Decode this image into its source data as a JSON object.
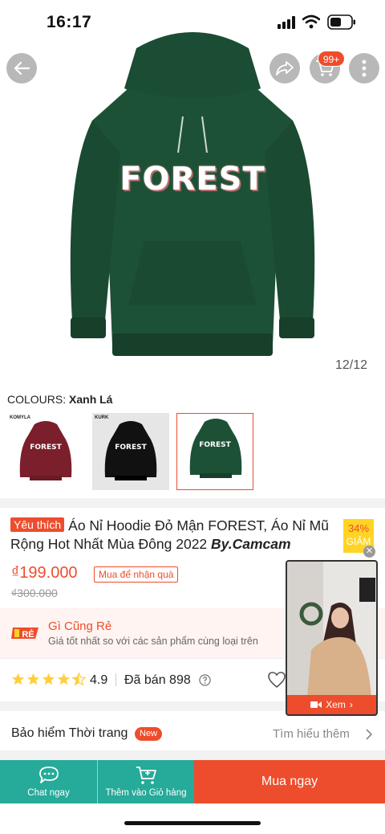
{
  "status_bar": {
    "time": "16:17"
  },
  "hero": {
    "print_text": "FOREST",
    "image_counter": "12/12",
    "cart_badge": "99+"
  },
  "colours": {
    "label": "COLOURS:",
    "selected": "Xanh Lá",
    "variants": [
      {
        "name": "maroon",
        "color": "#7a1f2b",
        "brand": "KOMYLA",
        "print": "FOREST"
      },
      {
        "name": "black",
        "color": "#111111",
        "brand": "KURK",
        "print": "FOREST"
      },
      {
        "name": "green",
        "color": "#1d5136",
        "print": "FOREST",
        "selected": true
      }
    ]
  },
  "product": {
    "fav_tag": "Yêu thích",
    "title": "Áo Nỉ Hoodie Đỏ Mận FOREST, Áo Nỉ Mũ Rộng Hot Nhất Mùa Đông 2022",
    "brand": "By.Camcam",
    "discount_pct": "34%",
    "discount_label": "GIẢM",
    "price": "₫199.000",
    "promo_chip": "Mua để nhận quà",
    "old_price": "₫300.000"
  },
  "cheap_banner": {
    "logo_text": "RẺ",
    "title": "Gì Cũng Rẻ",
    "subtitle": "Giá tốt nhất so với các sản phẩm cùng loại trên"
  },
  "rating": {
    "stars": 4.5,
    "value": "4.9",
    "sold": "Đã bán 898"
  },
  "insurance": {
    "label": "Bảo hiểm Thời trang",
    "badge": "New",
    "link": "Tìm hiểu thêm"
  },
  "video": {
    "label": "Xem"
  },
  "bottom_bar": {
    "chat": "Chat ngay",
    "add_to_cart": "Thêm vào Giỏ hàng",
    "buy_now": "Mua ngay"
  },
  "colors": {
    "accent": "#ee4d2d",
    "teal": "#26aa99",
    "hoodie_green": "#1d5136"
  }
}
